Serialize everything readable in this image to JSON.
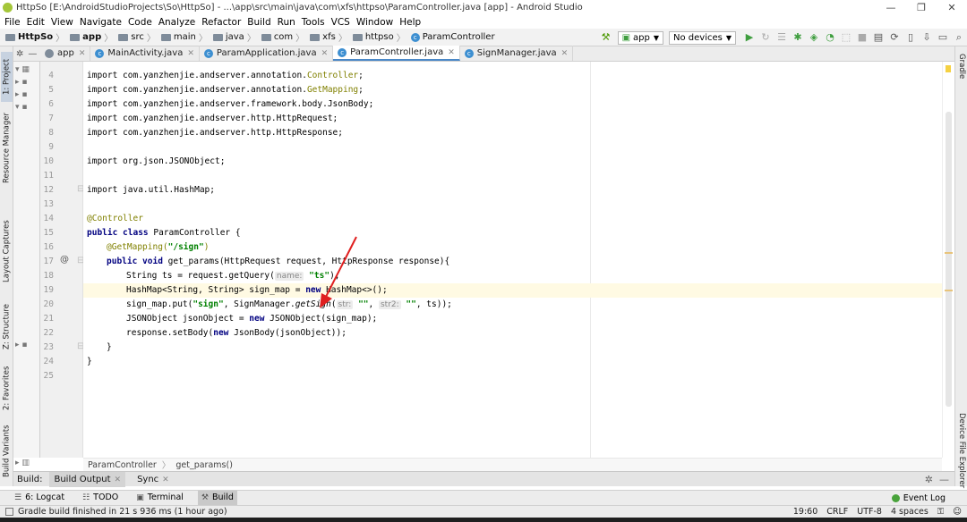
{
  "window": {
    "title": "HttpSo [E:\\AndroidStudioProjects\\So\\HttpSo] - ...\\app\\src\\main\\java\\com\\xfs\\httpso\\ParamController.java [app] - Android Studio",
    "minimize": "—",
    "maximize": "❐",
    "close": "✕"
  },
  "menu": [
    "File",
    "Edit",
    "View",
    "Navigate",
    "Code",
    "Analyze",
    "Refactor",
    "Build",
    "Run",
    "Tools",
    "VCS",
    "Window",
    "Help"
  ],
  "navbar": {
    "crumbs": [
      "HttpSo",
      "app",
      "src",
      "main",
      "java",
      "com",
      "xfs",
      "httpso",
      "ParamController"
    ],
    "config": "app",
    "devices": "No devices"
  },
  "left_tabs": [
    "1: Project",
    "Resource Manager",
    "Layout Captures",
    "Z: Structure",
    "2: Favorites",
    "Build Variants"
  ],
  "right_tabs": [
    "Gradle",
    "Device File Explorer"
  ],
  "tabs": [
    {
      "label": "app",
      "active": false
    },
    {
      "label": "MainActivity.java",
      "active": false
    },
    {
      "label": "ParamApplication.java",
      "active": false
    },
    {
      "label": "ParamController.java",
      "active": true
    },
    {
      "label": "SignManager.java",
      "active": false
    }
  ],
  "line_numbers": [
    "4",
    "5",
    "6",
    "7",
    "8",
    "9",
    "10",
    "11",
    "12",
    "13",
    "14",
    "15",
    "16",
    "17",
    "18",
    "19",
    "20",
    "21",
    "22",
    "23",
    "24",
    "25"
  ],
  "code": {
    "l4a": "import com.yanzhenjie.andserver.annotation.",
    "l4b": "Controller",
    "l4c": ";",
    "l5a": "import com.yanzhenjie.andserver.annotation.",
    "l5b": "GetMapping",
    "l5c": ";",
    "l6": "import com.yanzhenjie.andserver.framework.body.JsonBody;",
    "l7": "import com.yanzhenjie.andserver.http.HttpRequest;",
    "l8": "import com.yanzhenjie.andserver.http.HttpResponse;",
    "l10": "import org.json.JSONObject;",
    "l12": "import java.util.HashMap;",
    "l14": "@Controller",
    "l15a": "public class",
    "l15b": " ParamController {",
    "l16a": "@GetMapping(",
    "l16b": "\"/sign\"",
    "l16c": ")",
    "l17a": "public void",
    "l17b": " get_params(HttpRequest request, HttpResponse response){",
    "l18a": "String ts = request.getQuery(",
    "l18h": "name:",
    "l18b": "\"ts\"",
    "l18c": ");",
    "l19a": "HashMap<String, String> sign_map = ",
    "l19k": "new",
    "l19b": " HashMap<>();",
    "l20a": "sign_map.put(",
    "l20s": "\"sign\"",
    "l20b": ", SignManager.",
    "l20i": "getSign",
    "l20c": "(",
    "l20h1": "str:",
    "l20s2": "\"\"",
    "l20d": ", ",
    "l20h2": "str2:",
    "l20s3": "\"\"",
    "l20e": ", ts));",
    "l21a": "JSONObject jsonObject = ",
    "l21k": "new",
    "l21b": " JSONObject(sign_map);",
    "l22a": "response.setBody(",
    "l22k": "new",
    "l22b": " JsonBody(jsonObject));",
    "l23": "}",
    "l24": "}"
  },
  "gutter_annotation": "@",
  "editor_breadcrumb": [
    "ParamController",
    "get_params()"
  ],
  "build_bar": {
    "label": "Build:",
    "tabs": [
      {
        "label": "Build Output",
        "active": true
      },
      {
        "label": "Sync",
        "active": false
      }
    ]
  },
  "tool_windows": [
    {
      "label": "6: Logcat",
      "icon": "logcat-icon",
      "active": false
    },
    {
      "label": "TODO",
      "icon": "todo-icon",
      "active": false
    },
    {
      "label": "Terminal",
      "icon": "terminal-icon",
      "active": false
    },
    {
      "label": "Build",
      "icon": "hammer-icon",
      "active": true
    }
  ],
  "event_log": "Event Log",
  "status": {
    "message": "Gradle build finished in 21 s 936 ms (1 hour ago)",
    "position": "19:60",
    "line_sep": "CRLF",
    "encoding": "UTF-8",
    "indent": "4 spaces"
  },
  "colors": {
    "keyword": "#000080",
    "annotation": "#808000",
    "string": "#008000",
    "arrow": "#e02020",
    "active_tab_underline": "#4a88c7"
  }
}
